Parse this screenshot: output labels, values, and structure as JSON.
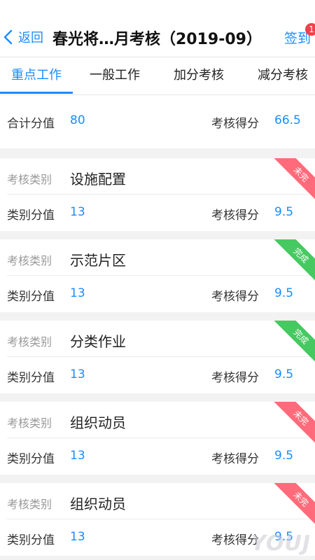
{
  "nav": {
    "back_label": "返回",
    "title": "春光将…月考核（2019-09）",
    "signin_label": "签到",
    "badge_count": "1"
  },
  "tabs": [
    {
      "label": "重点工作",
      "active": true
    },
    {
      "label": "一般工作",
      "active": false
    },
    {
      "label": "加分考核",
      "active": false
    },
    {
      "label": "减分考核",
      "active": false
    }
  ],
  "summary": {
    "total_label": "合计分值",
    "total_value": "80",
    "score_label": "考核得分",
    "score_value": "66.5"
  },
  "cards": [
    {
      "type_label": "考核类别",
      "type_value": "设施配置",
      "value_label": "类别分值",
      "value": "13",
      "score_label": "考核得分",
      "score": "9.5",
      "status": "未完",
      "status_color": "#ff6b7a"
    },
    {
      "type_label": "考核类别",
      "type_value": "示范片区",
      "value_label": "类别分值",
      "value": "13",
      "score_label": "考核得分",
      "score": "9.5",
      "status": "完成",
      "status_color": "#45c960"
    },
    {
      "type_label": "考核类别",
      "type_value": "分类作业",
      "value_label": "类别分值",
      "value": "13",
      "score_label": "考核得分",
      "score": "9.5",
      "status": "完成",
      "status_color": "#45c960"
    },
    {
      "type_label": "考核类别",
      "type_value": "组织动员",
      "value_label": "类别分值",
      "value": "13",
      "score_label": "考核得分",
      "score": "9.5",
      "status": "未完",
      "status_color": "#ff6b7a"
    },
    {
      "type_label": "考核类别",
      "type_value": "组织动员",
      "value_label": "类别分值",
      "value": "13",
      "score_label": "考核得分",
      "score": "9.5",
      "status": "未完",
      "status_color": "#ff6b7a"
    }
  ],
  "watermark": "YOUJ"
}
